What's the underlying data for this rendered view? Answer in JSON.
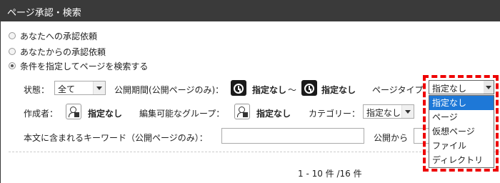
{
  "title": "ページ承認・検索",
  "radios": [
    {
      "label": "あなたへの承認依頼",
      "checked": false
    },
    {
      "label": "あなたからの承認依頼",
      "checked": false
    },
    {
      "label": "条件を指定してページを検索する",
      "checked": true
    }
  ],
  "row1": {
    "status_label": "状態：",
    "status_value": "全て",
    "period_label": "公開期間(公開ページのみ)：",
    "period_start": "指定なし",
    "tilde": "～",
    "period_end": "指定なし",
    "page_type_label": "ページタイプ"
  },
  "row2": {
    "creator_label": "作成者：",
    "creator_value": "指定なし",
    "group_label": "編集可能なグループ：",
    "group_value": "指定なし",
    "category_label": "カテゴリー：",
    "category_value": "指定なし"
  },
  "row3": {
    "keyword_label": "本文に含まれるキーワード（公開ページのみ）：",
    "publish_from_label": "公開から"
  },
  "page_type_dropdown": {
    "selected": "指定なし",
    "options": [
      "指定なし",
      "ページ",
      "仮想ページ",
      "ファイル",
      "ディレクトリ"
    ]
  },
  "pagination": "1 - 10 件 /16 件",
  "colors": {
    "titlebar": "#3a3a3a",
    "highlight": "#e00000",
    "selected_option": "#1e78d7"
  }
}
